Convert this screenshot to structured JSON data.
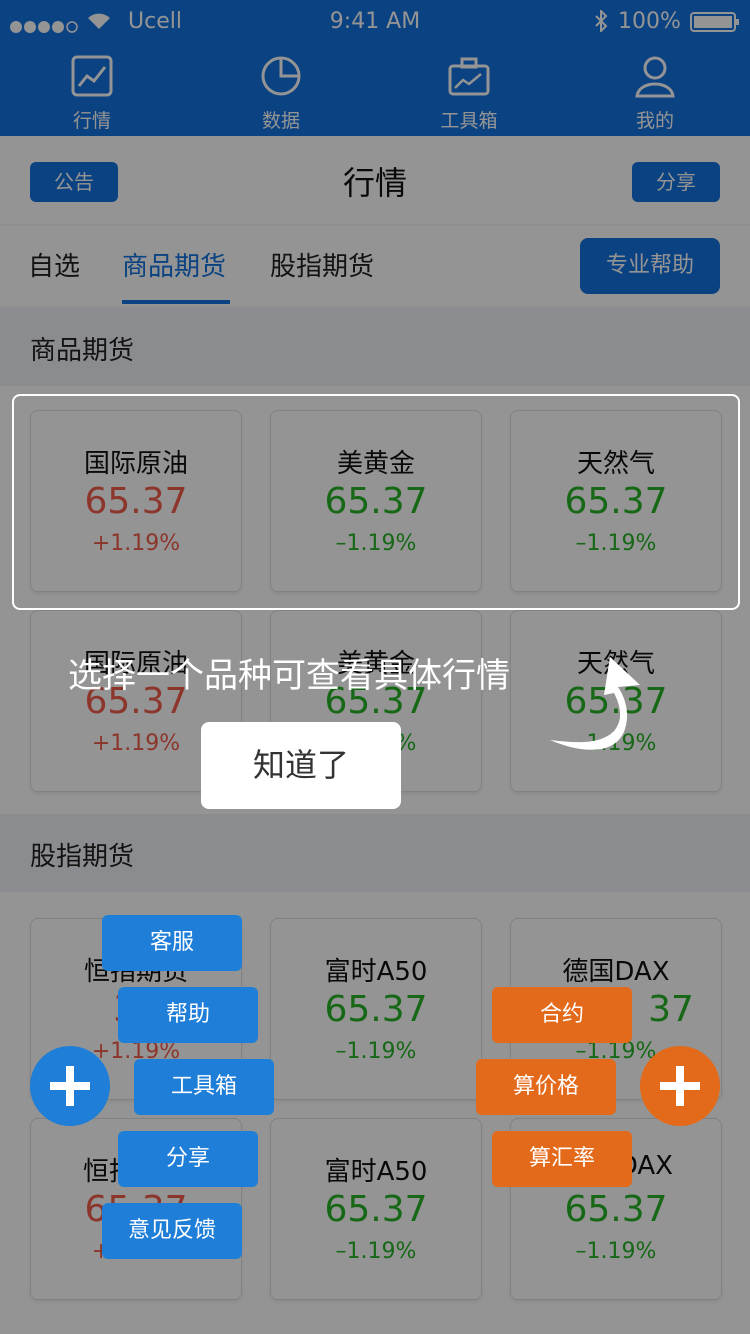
{
  "status_bar": {
    "carrier": "Ucell",
    "time": "9:41 AM",
    "battery": "100%"
  },
  "bottom_nav": [
    {
      "label": "行情",
      "icon": "chart-line-icon"
    },
    {
      "label": "数据",
      "icon": "pie-chart-icon"
    },
    {
      "label": "工具箱",
      "icon": "toolbox-icon"
    },
    {
      "label": "我的",
      "icon": "user-icon"
    }
  ],
  "header": {
    "left_button": "公告",
    "title": "行情",
    "right_button": "分享"
  },
  "tabs": {
    "items": [
      "自选",
      "商品期货",
      "股指期货"
    ],
    "active_index": 1,
    "help_button": "专业帮助"
  },
  "sections": {
    "commodity": {
      "title": "商品期货",
      "cards": [
        {
          "name": "国际原油",
          "price": "65.37",
          "change": "+1.19%",
          "trend": "up"
        },
        {
          "name": "美黄金",
          "price": "65.37",
          "change": "–1.19%",
          "trend": "down"
        },
        {
          "name": "天然气",
          "price": "65.37",
          "change": "–1.19%",
          "trend": "down"
        },
        {
          "name": "国际原油",
          "price": "65.37",
          "change": "+1.19%",
          "trend": "up"
        },
        {
          "name": "美黄金",
          "price": "65.37",
          "change": "–1.19%",
          "trend": "down"
        },
        {
          "name": "天然气",
          "price": "65.37",
          "change": "–1.19%",
          "trend": "down"
        }
      ]
    },
    "index": {
      "title": "股指期货",
      "cards": [
        {
          "name": "恒指期货",
          "price": "31",
          "change": "+1.19%",
          "trend": "up"
        },
        {
          "name": "富时A50",
          "price": "65.37",
          "change": "–1.19%",
          "trend": "down"
        },
        {
          "name": "德国DAX",
          "price": "37",
          "change": "–1.19%",
          "trend": "down"
        },
        {
          "name": "恒指",
          "price": "65.37",
          "change": "+1.19%",
          "trend": "up"
        },
        {
          "name": "富时A50",
          "price": "65.37",
          "change": "–1.19%",
          "trend": "down"
        },
        {
          "name": "DAX",
          "price": "65.37",
          "change": "–1.19%",
          "trend": "down"
        }
      ]
    }
  },
  "overlay": {
    "guide_text": "选择一个品种可查看具体行情",
    "confirm_button": "知道了"
  },
  "fab_left_menu": [
    "客服",
    "帮助",
    "工具箱",
    "分享",
    "意见反馈"
  ],
  "fab_right_menu": [
    "合约",
    "算价格",
    "算汇率"
  ],
  "colors": {
    "primary": "#1373e0",
    "up": "#f25c4a",
    "down": "#27b327",
    "orange": "#e36a1b"
  }
}
